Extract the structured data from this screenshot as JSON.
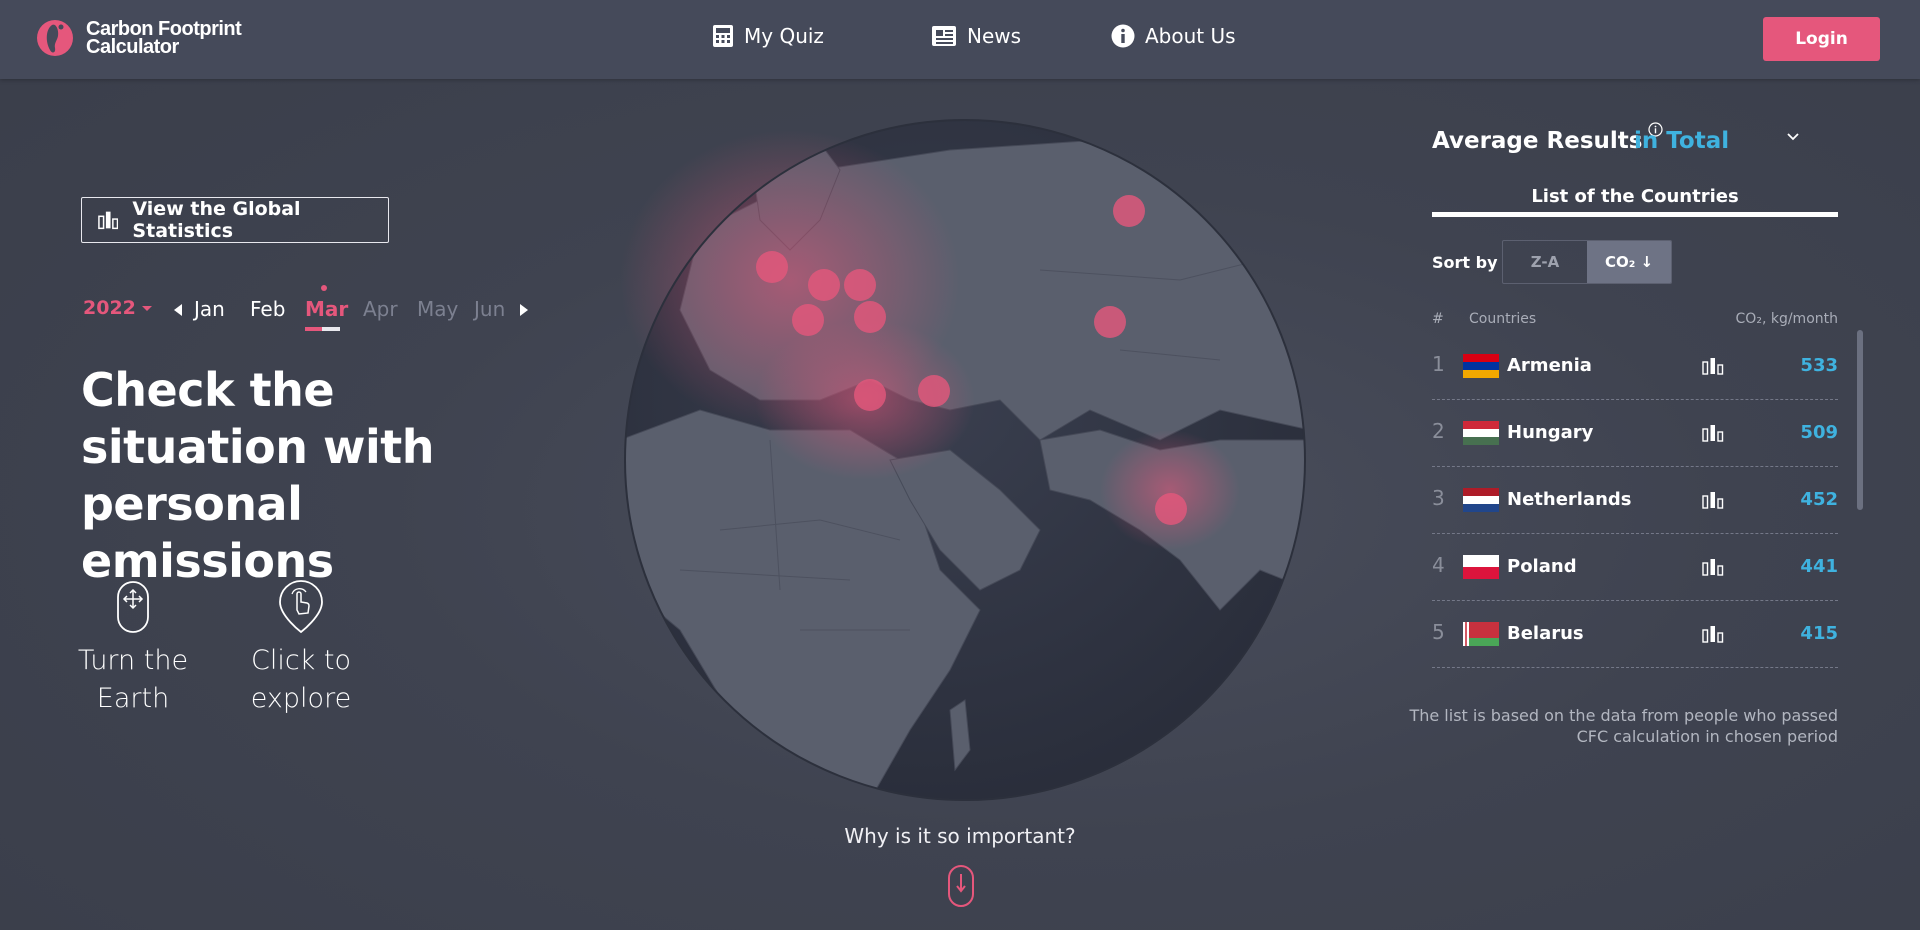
{
  "header": {
    "logo_line1": "Carbon Footprint",
    "logo_line2": "Calculator",
    "nav": [
      {
        "label": "My Quiz",
        "icon": "calculator-icon"
      },
      {
        "label": "News",
        "icon": "newspaper-icon"
      },
      {
        "label": "About Us",
        "icon": "info-icon"
      }
    ],
    "login_label": "Login"
  },
  "left": {
    "stats_button_label": "View the Global Statistics",
    "year": "2022",
    "months": [
      "Jan",
      "Feb",
      "Mar",
      "Apr",
      "May",
      "Jun"
    ],
    "active_month": "Mar",
    "headline": "Check the situation with personal emissions",
    "hints": [
      {
        "line1": "Turn the",
        "line2": "Earth",
        "icon": "drag-move-icon"
      },
      {
        "line1": "Click to",
        "line2": "explore",
        "icon": "pointer-click-icon"
      }
    ]
  },
  "center": {
    "why_label": "Why is it so important?",
    "scroll_icon": "scroll-down-icon"
  },
  "right": {
    "title": "Average Results",
    "mode": "in Total",
    "list_title": "List of the Countries",
    "sort_label": "Sort by",
    "sort_options": [
      "Z-A",
      "CO₂ ↓"
    ],
    "selected_sort": "CO₂ ↓",
    "col_rank": "#",
    "col_country": "Countries",
    "col_value": "CO₂, kg/month",
    "rows": [
      {
        "rank": "1",
        "country": "Armenia",
        "value": "533"
      },
      {
        "rank": "2",
        "country": "Hungary",
        "value": "509"
      },
      {
        "rank": "3",
        "country": "Netherlands",
        "value": "452"
      },
      {
        "rank": "4",
        "country": "Poland",
        "value": "441"
      },
      {
        "rank": "5",
        "country": "Belarus",
        "value": "415"
      }
    ],
    "note": "The list is based on the data from people who passed CFC calculation in chosen period"
  },
  "colors": {
    "accent": "#e5577c",
    "link": "#3fb2df",
    "header_bg": "#454a5a",
    "page_bg": "#3f4350"
  }
}
